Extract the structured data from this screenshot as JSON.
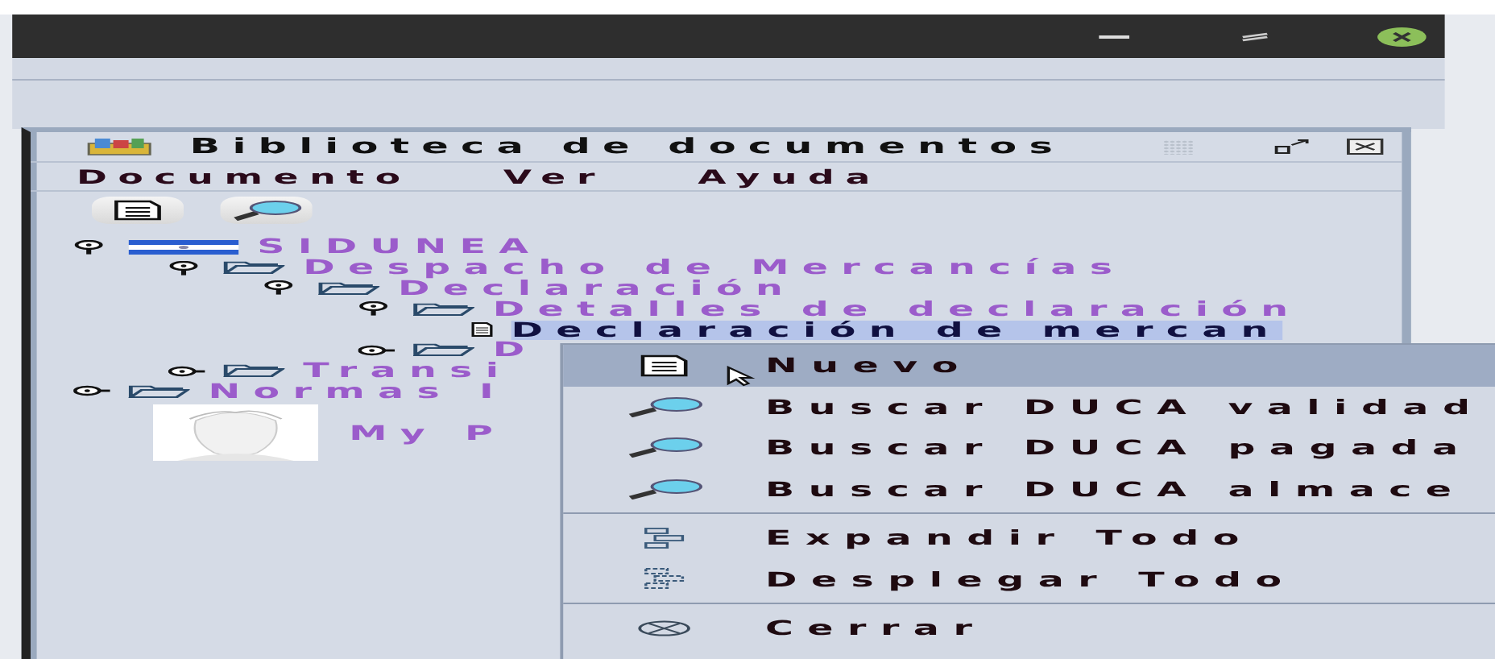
{
  "library": {
    "title": "Biblioteca de documentos",
    "menu": [
      "Documento",
      "Ver",
      "Ayuda"
    ],
    "tree": [
      {
        "label": "SIDUNEA",
        "kind": "flag",
        "expanded": true,
        "selected": false,
        "children": [
          {
            "label": "Despacho de Mercancías",
            "kind": "folder",
            "expanded": true,
            "selected": false,
            "children": [
              {
                "label": "Declaración",
                "kind": "folder",
                "expanded": true,
                "selected": false,
                "children": [
                  {
                    "label": "Detalles de declaración",
                    "kind": "folder",
                    "expanded": true,
                    "selected": false,
                    "children": [
                      {
                        "label": "Declaración de mercan",
                        "kind": "document",
                        "selected": true
                      }
                    ]
                  },
                  {
                    "label": "D",
                    "kind": "folder",
                    "expanded": false,
                    "selected": false
                  }
                ]
              }
            ]
          },
          {
            "label": "Transi",
            "kind": "folder",
            "expanded": false,
            "selected": false
          }
        ]
      },
      {
        "label": "Normas I",
        "kind": "folder",
        "expanded": false,
        "selected": false
      }
    ],
    "user": {
      "name": "My P"
    }
  },
  "context_menu": {
    "groups": [
      [
        {
          "label": "Nuevo",
          "kind": "new",
          "selected": true
        },
        {
          "label": "Buscar DUCA validad",
          "kind": "search",
          "selected": false
        },
        {
          "label": "Buscar DUCA pagada",
          "kind": "search",
          "selected": false
        },
        {
          "label": "Buscar DUCA almace",
          "kind": "search",
          "selected": false
        }
      ],
      [
        {
          "label": "Expandir Todo",
          "kind": "expand",
          "selected": false
        },
        {
          "label": "Desplegar Todo",
          "kind": "collapse",
          "selected": false
        }
      ],
      [
        {
          "label": "Cerrar",
          "kind": "close",
          "selected": false
        }
      ]
    ]
  }
}
